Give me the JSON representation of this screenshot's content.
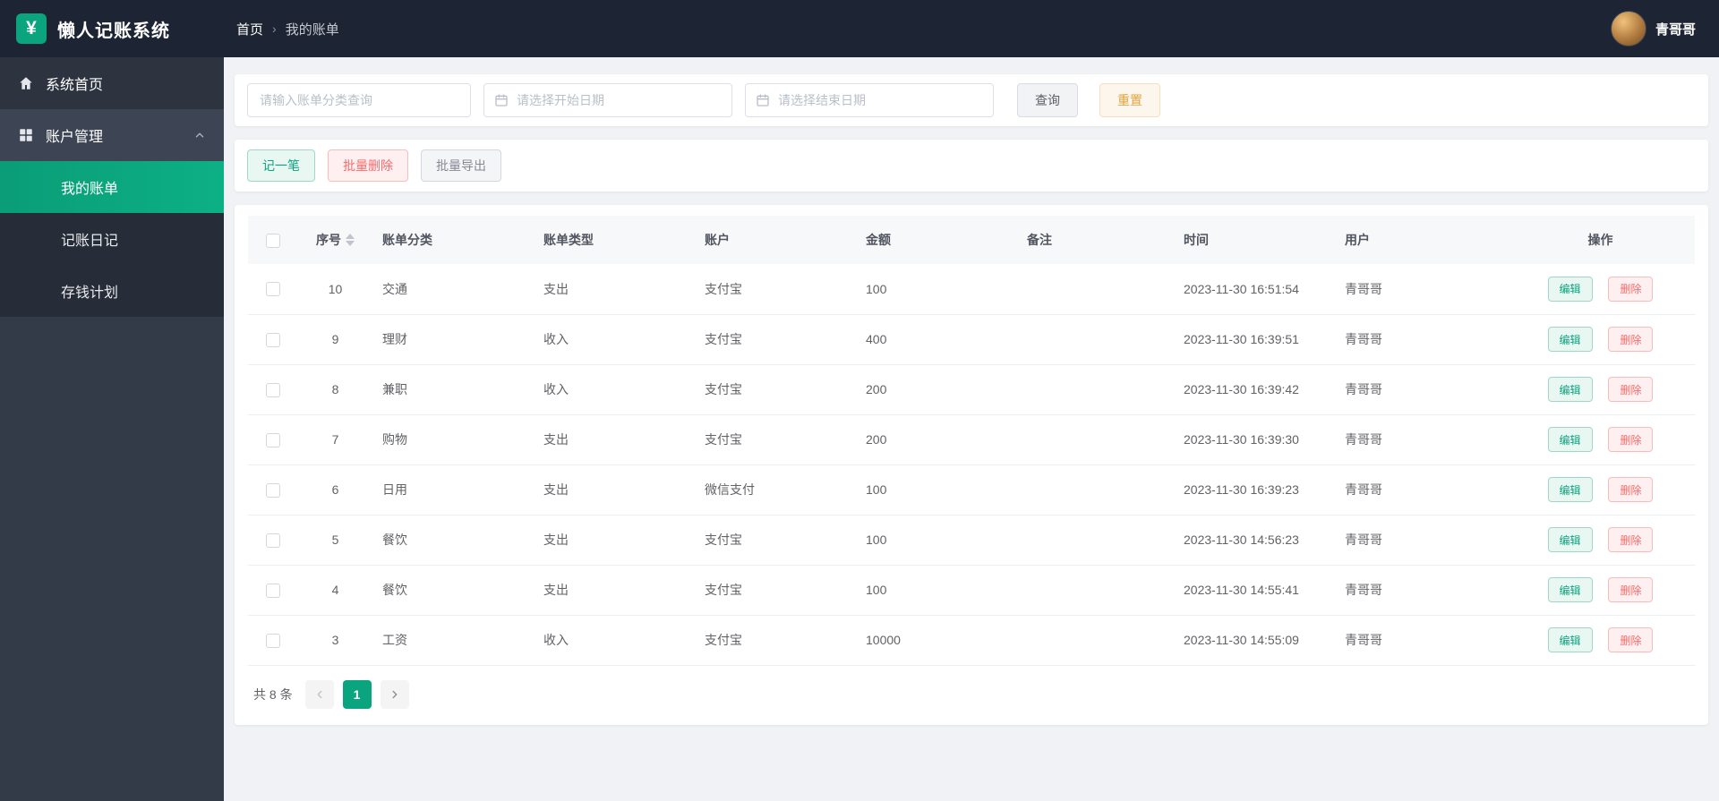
{
  "app": {
    "title": "懒人记账系统",
    "logo_glyph": "¥"
  },
  "header": {
    "breadcrumb": {
      "home": "首页",
      "separator": "›",
      "current": "我的账单"
    },
    "user": {
      "name": "青哥哥"
    }
  },
  "sidebar": {
    "items": [
      {
        "label": "系统首页",
        "icon": "home-icon"
      },
      {
        "label": "账户管理",
        "icon": "grid-icon",
        "expanded": true,
        "children": [
          {
            "label": "我的账单",
            "active": true
          },
          {
            "label": "记账日记",
            "active": false
          },
          {
            "label": "存钱计划",
            "active": false
          }
        ]
      }
    ]
  },
  "filters": {
    "category_placeholder": "请输入账单分类查询",
    "start_date_placeholder": "请选择开始日期",
    "end_date_placeholder": "请选择结束日期",
    "search_label": "查询",
    "reset_label": "重置"
  },
  "actions": {
    "add_label": "记一笔",
    "batch_delete_label": "批量删除",
    "batch_export_label": "批量导出"
  },
  "table": {
    "columns": [
      "序号",
      "账单分类",
      "账单类型",
      "账户",
      "金额",
      "备注",
      "时间",
      "用户",
      "操作"
    ],
    "edit_label": "编辑",
    "delete_label": "删除",
    "rows": [
      {
        "seq": "10",
        "category": "交通",
        "type": "支出",
        "account": "支付宝",
        "amount": "100",
        "note": "",
        "time": "2023-11-30 16:51:54",
        "user": "青哥哥"
      },
      {
        "seq": "9",
        "category": "理财",
        "type": "收入",
        "account": "支付宝",
        "amount": "400",
        "note": "",
        "time": "2023-11-30 16:39:51",
        "user": "青哥哥"
      },
      {
        "seq": "8",
        "category": "兼职",
        "type": "收入",
        "account": "支付宝",
        "amount": "200",
        "note": "",
        "time": "2023-11-30 16:39:42",
        "user": "青哥哥"
      },
      {
        "seq": "7",
        "category": "购物",
        "type": "支出",
        "account": "支付宝",
        "amount": "200",
        "note": "",
        "time": "2023-11-30 16:39:30",
        "user": "青哥哥"
      },
      {
        "seq": "6",
        "category": "日用",
        "type": "支出",
        "account": "微信支付",
        "amount": "100",
        "note": "",
        "time": "2023-11-30 16:39:23",
        "user": "青哥哥"
      },
      {
        "seq": "5",
        "category": "餐饮",
        "type": "支出",
        "account": "支付宝",
        "amount": "100",
        "note": "",
        "time": "2023-11-30 14:56:23",
        "user": "青哥哥"
      },
      {
        "seq": "4",
        "category": "餐饮",
        "type": "支出",
        "account": "支付宝",
        "amount": "100",
        "note": "",
        "time": "2023-11-30 14:55:41",
        "user": "青哥哥"
      },
      {
        "seq": "3",
        "category": "工资",
        "type": "收入",
        "account": "支付宝",
        "amount": "10000",
        "note": "",
        "time": "2023-11-30 14:55:09",
        "user": "青哥哥"
      }
    ]
  },
  "pagination": {
    "total_text": "共 8 条",
    "current_page": "1"
  },
  "colors": {
    "accent": "#0aa47e",
    "danger": "#f56c6c",
    "warning": "#e6a23c",
    "info": "#909399",
    "header_bg": "#1d2433",
    "sidebar_bg": "#343b48"
  }
}
